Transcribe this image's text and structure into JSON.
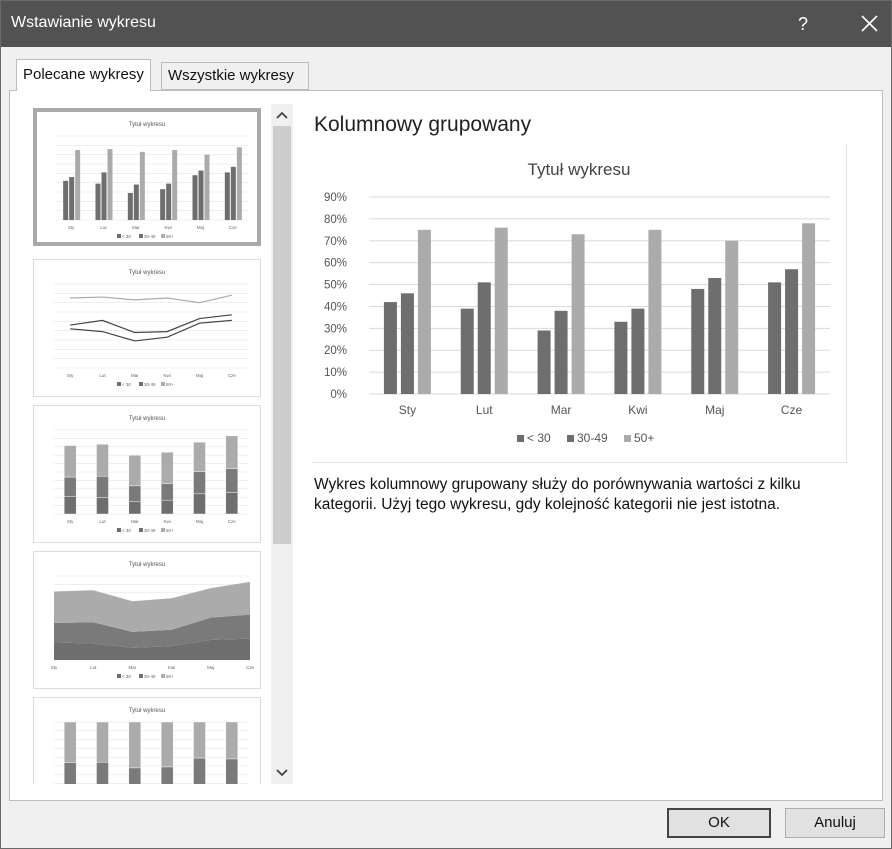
{
  "window": {
    "title": "Wstawianie wykresu",
    "help_label": "?"
  },
  "tabs": [
    {
      "label": "Polecane wykresy",
      "active": true
    },
    {
      "label": "Wszystkie wykresy",
      "active": false
    }
  ],
  "thumbnails": [
    {
      "kind": "clustered-column",
      "title": "Tytuł wykresu",
      "selected": true
    },
    {
      "kind": "line",
      "title": "Tytuł wykresu",
      "selected": false
    },
    {
      "kind": "stacked-column",
      "title": "Tytuł wykresu",
      "selected": false
    },
    {
      "kind": "stacked-area",
      "title": "Tytuł wykresu",
      "selected": false
    },
    {
      "kind": "100-stacked-column",
      "title": "Tytuł wykresu",
      "selected": false
    }
  ],
  "preview": {
    "heading": "Kolumnowy grupowany",
    "description": "Wykres kolumnowy grupowany służy do porównywania wartości z kilku kategorii. Użyj tego wykresu, gdy kolejność kategorii nie jest istotna."
  },
  "chart_data": {
    "type": "bar",
    "title": "Tytuł wykresu",
    "categories": [
      "Sty",
      "Lut",
      "Mar",
      "Kwi",
      "Maj",
      "Cze"
    ],
    "series": [
      {
        "name": "< 30",
        "values": [
          42,
          39,
          29,
          33,
          48,
          51
        ],
        "color": "#6e6e6e"
      },
      {
        "name": "30-49",
        "values": [
          46,
          51,
          38,
          39,
          53,
          57
        ],
        "color": "#6e6e6e"
      },
      {
        "name": "50+",
        "values": [
          75,
          76,
          73,
          75,
          70,
          78
        ],
        "color": "#ababab"
      }
    ],
    "yticks": [
      "0%",
      "10%",
      "20%",
      "30%",
      "40%",
      "50%",
      "60%",
      "70%",
      "80%",
      "90%"
    ],
    "ylim": [
      0,
      90
    ],
    "grid": true,
    "legend": "bottom"
  },
  "buttons": {
    "ok": "OK",
    "cancel": "Anuluj"
  },
  "colors": {
    "titlebar": "#525252",
    "dark_series": "#6e6e6e",
    "light_series": "#ababab",
    "selected_border": "#a9a9a9"
  }
}
